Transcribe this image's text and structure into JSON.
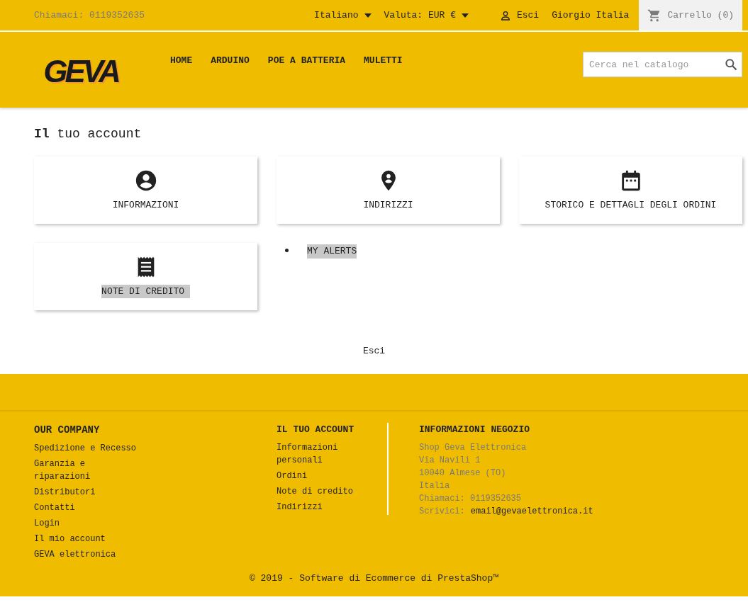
{
  "topbar": {
    "phone": "Chiamaci: 0119352635",
    "language": "Italiano",
    "currency": "Valuta: EUR €",
    "logout": "Esci",
    "user": "Giorgio Italia",
    "cart": "Carrello (0)"
  },
  "header": {
    "logo": "GEVA",
    "menu": [
      "HOME",
      "ARDUINO",
      "POE A BATTERIA",
      "MULETTI"
    ],
    "search": {
      "placeholder": "Cerca nel catalogo"
    }
  },
  "page_title": "Il tuo account",
  "account_links": [
    {
      "kind": "user",
      "label": "INFORMAZIONI",
      "highlighted": false
    },
    {
      "kind": "pin",
      "label": "INDIRIZZI",
      "highlighted": false
    },
    {
      "kind": "calendar",
      "label": "STORICO E DETTAGLI DEGLI ORDINI",
      "highlighted": false
    },
    {
      "kind": "receipt",
      "label": "NOTE DI CREDITO ",
      "highlighted": true
    }
  ],
  "alerts_link": {
    "label": "MY ALERTS",
    "highlighted": true
  },
  "logout_link": "Esci",
  "footer": {
    "columns": [
      {
        "kind": "links",
        "title": "OUR COMPANY",
        "items": [
          "Spedizione e Recesso",
          "Garanzia e riparazioni",
          "Distributori",
          "Contatti",
          "Login",
          "Il mio account",
          "GEVA elettronica"
        ]
      },
      {
        "kind": "links",
        "title": "IL TUO ACCOUNT",
        "items": [
          "Informazioni personali",
          "Ordini",
          "Note di credito",
          "Indirizzi"
        ]
      }
    ],
    "store": {
      "title": "INFORMAZIONI NEGOZIO",
      "lines": [
        "Shop Geva Elettronica",
        "Via Navili 1",
        "10040 Almese (TO)",
        "Italia",
        "Chiamaci: 0119352635"
      ],
      "email_label": "Scrivici:",
      "email": "email@gevaelettronica.it"
    },
    "copyright": "© 2019 - Software di Ecommerce di PrestaShop™"
  }
}
